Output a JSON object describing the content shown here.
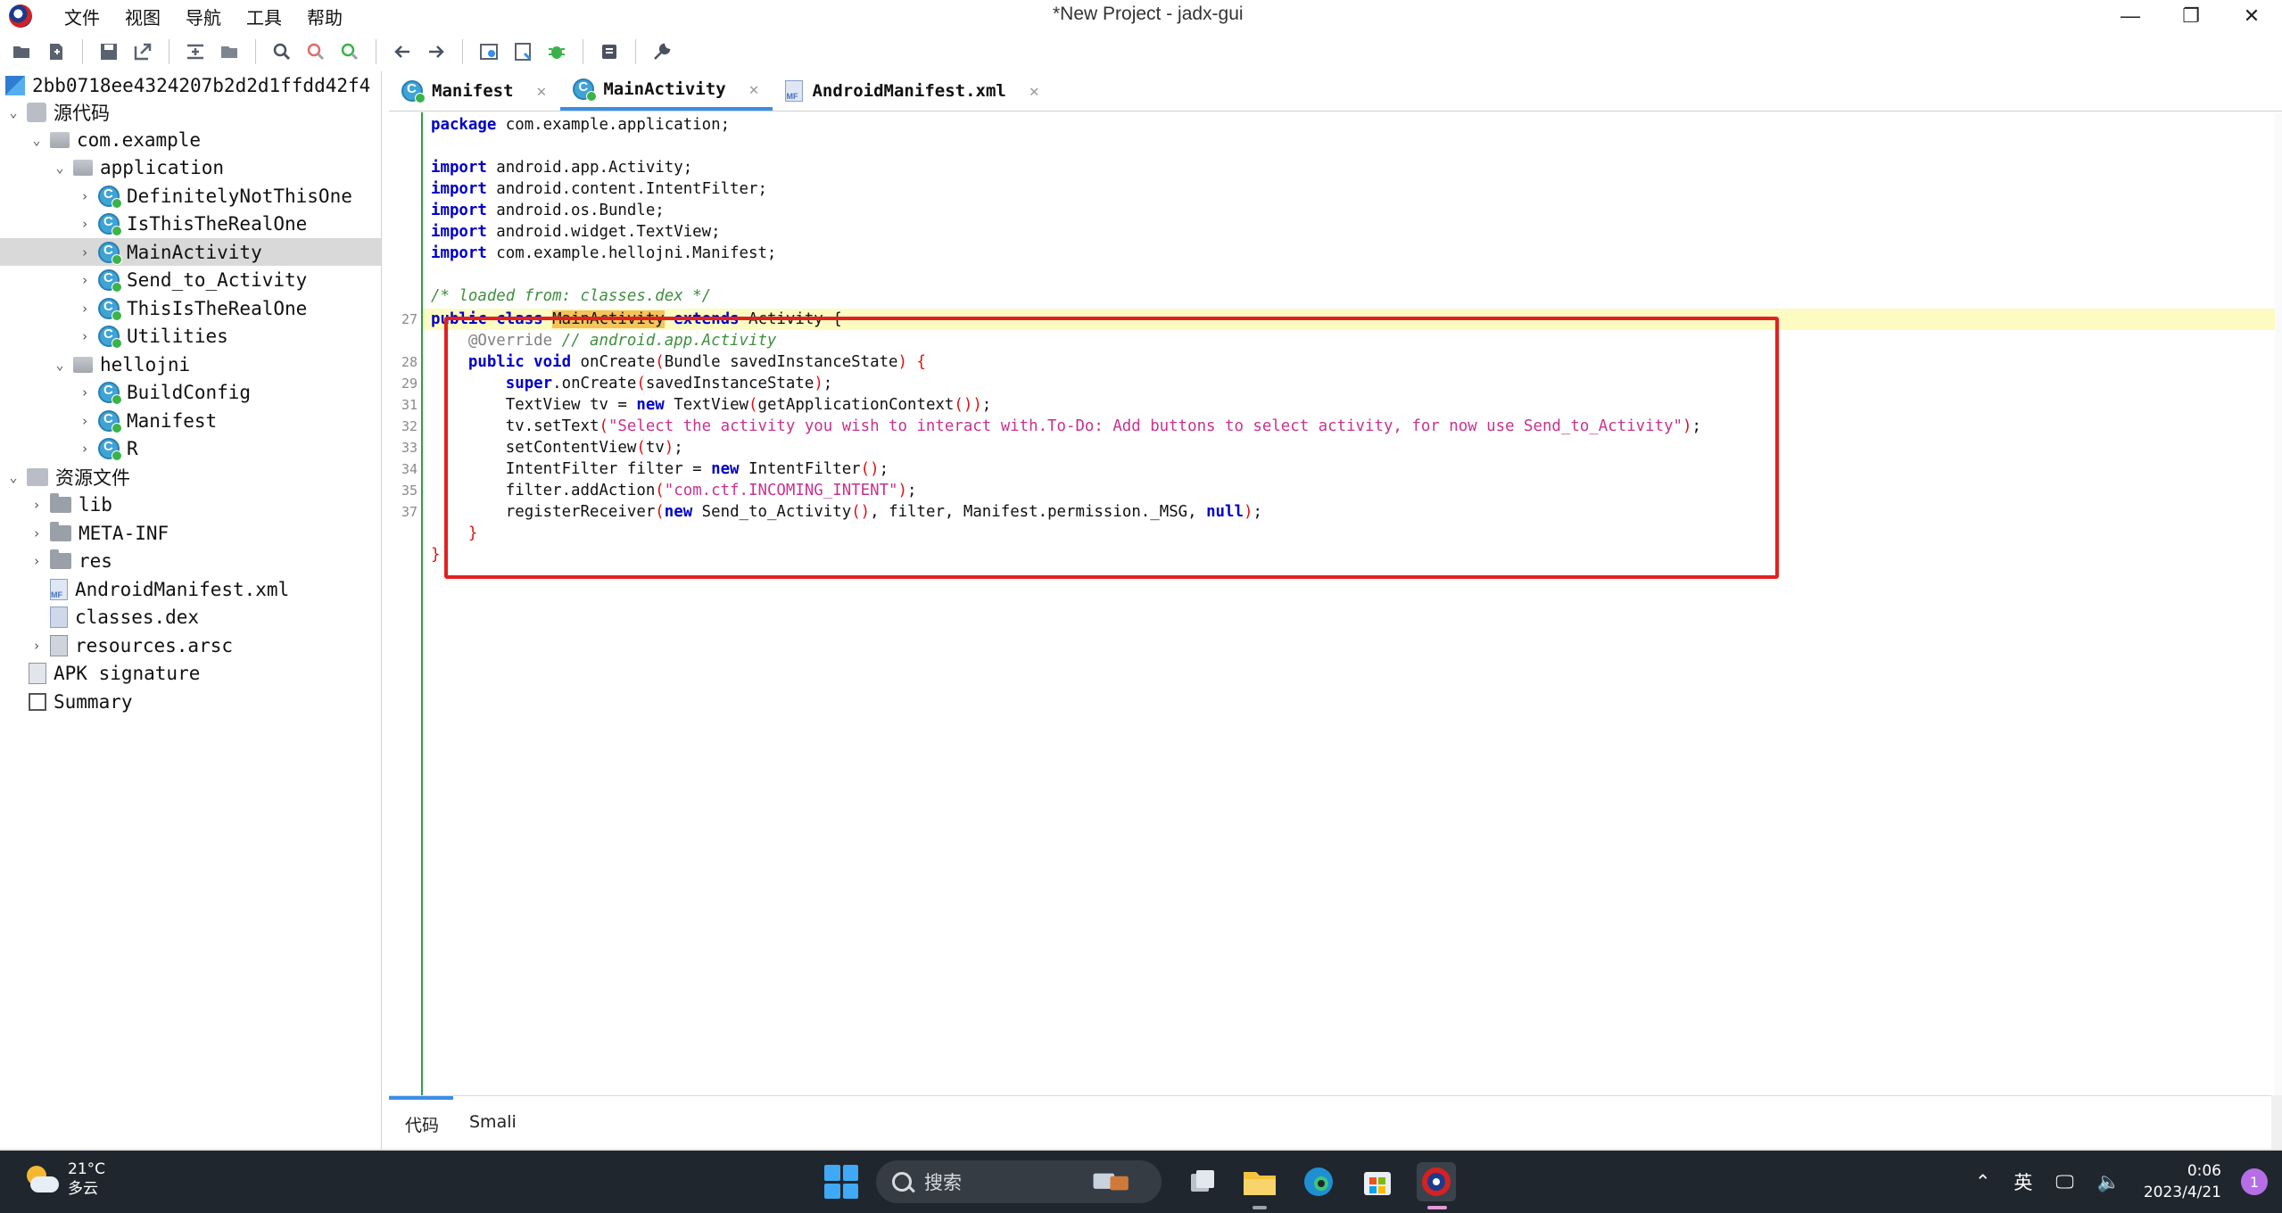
{
  "window": {
    "title": "*New Project - jadx-gui",
    "minimize": "—",
    "restore": "❐",
    "close": "✕"
  },
  "menu": [
    "文件",
    "视图",
    "导航",
    "工具",
    "帮助"
  ],
  "toolbar": [
    "open-icon",
    "add-files-icon",
    "save-all-icon",
    "export-icon",
    "sync-icon",
    "flatten-icon",
    "search-icon",
    "find-class-icon",
    "find-usage-icon",
    "back-icon",
    "forward-icon",
    "decompile-all-icon",
    "deobf-icon",
    "debug-icon",
    "log-icon",
    "preferences-icon"
  ],
  "tree": {
    "root": "2bb0718ee4324207b2d2d1ffdd42f4",
    "sources": "源代码",
    "pkg1": "com.example",
    "pkg2": "application",
    "classes_app": [
      "DefinitelyNotThisOne",
      "IsThisTheRealOne",
      "MainActivity",
      "Send_to_Activity",
      "ThisIsTheRealOne",
      "Utilities"
    ],
    "pkg3": "hellojni",
    "classes_jni": [
      "BuildConfig",
      "Manifest",
      "R"
    ],
    "resources": "资源文件",
    "res_items": [
      "lib",
      "META-INF",
      "res",
      "AndroidManifest.xml",
      "classes.dex",
      "resources.arsc"
    ],
    "apk_sig": "APK signature",
    "summary": "Summary"
  },
  "tabs": [
    {
      "label": "Manifest",
      "close": "✕"
    },
    {
      "label": "MainActivity",
      "close": "✕"
    },
    {
      "label": "AndroidManifest.xml",
      "close": "✕"
    }
  ],
  "code": {
    "line_numbers": [
      "27",
      "28",
      "29",
      "31",
      "32",
      "33",
      "34",
      "35",
      "37"
    ],
    "package_kw": "package",
    "package_name": " com.example.application;",
    "import_kw": "import",
    "imports": [
      " android.app.Activity;",
      " android.content.IntentFilter;",
      " android.os.Bundle;",
      " android.widget.TextView;",
      " com.example.hellojni.Manifest;"
    ],
    "loaded_comment": "/* loaded from: classes.dex */",
    "class_decl_kw": "public class ",
    "class_name": "MainActivity",
    "extends_kw": " extends ",
    "super_class": "Activity {",
    "override_anno": "@Override",
    "override_comment": " // android.app.Activity",
    "oncreate_kw": "public void ",
    "oncreate_sig": "onCreate",
    "oncreate_params": "Bundle savedInstanceState",
    "super_kw": "super",
    "super_call": ".onCreate",
    "super_arg": "savedInstanceState",
    "tv_decl": "TextView tv = ",
    "new_kw": "new",
    "tv_new": " TextView",
    "tv_arg": "getApplicationContext",
    "settext_call": "tv.setText",
    "settext_str": "\"Select the activity you wish to interact with.To-Do: Add buttons to select activity, for now use Send_to_Activity\"",
    "setcontent_call": "setContentView",
    "setcontent_arg": "tv",
    "filter_decl": "IntentFilter filter = ",
    "filter_new": " IntentFilter",
    "addaction_call": "filter.addAction",
    "addaction_str": "\"com.ctf.INCOMING_INTENT\"",
    "register_call": "registerReceiver",
    "register_new": " Send_to_Activity",
    "register_args": ", filter, Manifest.permission._MSG, ",
    "null_kw": "null",
    "close_method": "}",
    "close_class": "}"
  },
  "bottom_tabs": [
    "代码",
    "Smali"
  ],
  "taskbar": {
    "temperature": "21°C",
    "weather": "多云",
    "search": "搜索",
    "ime": "英",
    "time": "0:06",
    "date": "2023/4/21",
    "notifications": "1"
  },
  "colors": {
    "accent": "#3a8ee6",
    "highlight_box": "#e32020",
    "keyword": "#0000c8",
    "string": "#c8328e",
    "comment": "#3f8f3f"
  }
}
